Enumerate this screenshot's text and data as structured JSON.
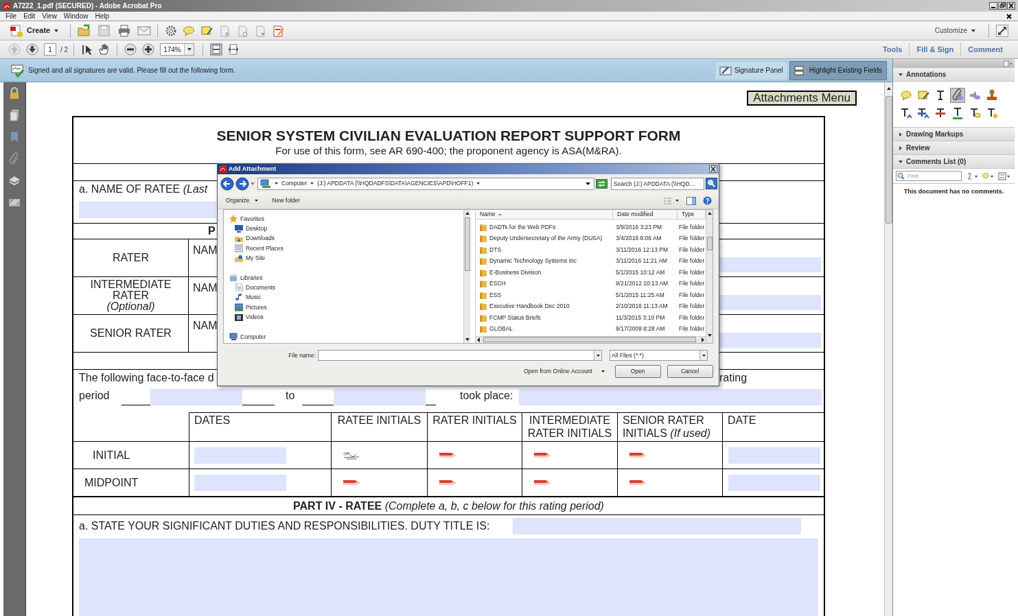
{
  "window": {
    "title": "A7222_1.pdf (SECURED) - Adobe Acrobat Pro"
  },
  "menu": [
    "File",
    "Edit",
    "View",
    "Window",
    "Help"
  ],
  "toolbar": {
    "create": "Create",
    "customize": "Customize"
  },
  "navigation": {
    "page": "1",
    "page_count": "/ 2",
    "zoom": "174%"
  },
  "task_tabs": [
    "Tools",
    "Fill & Sign",
    "Comment"
  ],
  "notice": {
    "message": "Signed and all signatures are valid.  Please fill out the following form.",
    "buttons": [
      {
        "label": "Signature Panel",
        "selected": false
      },
      {
        "label": "Highlight Existing Fields",
        "selected": true
      }
    ]
  },
  "right_panel": {
    "sections": [
      {
        "title": "Annotations",
        "expanded": true,
        "tools": [
          {
            "selected": false
          },
          {
            "selected": false
          },
          {
            "selected": false
          },
          {
            "selected": true
          },
          {
            "selected": false
          },
          {
            "selected": false
          },
          {
            "selected": false
          },
          {
            "selected": false
          },
          {
            "selected": false
          },
          {
            "selected": false
          },
          {
            "selected": false
          },
          {
            "selected": false
          }
        ]
      },
      {
        "title": "Drawing Markups",
        "expanded": false
      },
      {
        "title": "Review",
        "expanded": false
      },
      {
        "title": "Comments List (0)",
        "expanded": true,
        "find": {
          "placeholder": "Find"
        },
        "empty_message": "This document has no comments."
      }
    ]
  },
  "form": {
    "attachments_button": "Attachments Menu",
    "title": "SENIOR SYSTEM CIVILIAN EVALUATION REPORT SUPPORT FORM",
    "subtitle": "For use of this form, see AR 690-400; the proponent agency is ASA(M&RA).",
    "ratee_name_label": "a.  NAME OF RATEE  *(Last*",
    "part_heading": "P",
    "raters": [
      {
        "label": "RATER",
        "name_label": "NAM"
      },
      {
        "label": "INTERMEDIATE RATER",
        "note": "(Optional)",
        "name_label": "NAM"
      },
      {
        "label": "SENIOR RATER",
        "name_label": "NAM"
      }
    ],
    "counseling_text": "The following face-to-face d",
    "counseling_text_end": "rating",
    "period_label": "period",
    "to_label": "to",
    "took_place_label": "took place:",
    "table": {
      "columns": [
        "DATES",
        "RATEE INITIALS",
        "RATER INITIALS",
        "INTERMEDIATE RATER INITIALS",
        "SENIOR RATER INITIALS  *(If used)*",
        "DATE"
      ],
      "rows": [
        {
          "label": "INITIAL",
          "ratee_signed": true
        },
        {
          "label": "MIDPOINT",
          "ratee_signed": false
        }
      ]
    },
    "part_iv": "**PART IV - RATEE**  *(Complete a, b, c below for this rating period)*",
    "duties_label": "a.  STATE YOUR SIGNIFICANT DUTIES AND RESPONSIBILITIES. DUTY TITLE IS:"
  },
  "dialog": {
    "title": "Add Attachment",
    "path": [
      "Computer",
      "(J:) APDDATA (\\\\HQDADFS\\DATA\\AGENCIES\\APD\\HOFF1)"
    ],
    "search": {
      "placeholder": "Search (J:) APDDATA (\\\\HQD…"
    },
    "commands": [
      "Organize",
      "New folder"
    ],
    "tree": [
      {
        "label": "Favorites",
        "children": [
          {
            "label": "Desktop"
          },
          {
            "label": "Downloads"
          },
          {
            "label": "Recent Places"
          },
          {
            "label": "My Site"
          }
        ]
      },
      {
        "label": "Libraries",
        "children": [
          {
            "label": "Documents"
          },
          {
            "label": "Music"
          },
          {
            "label": "Pictures"
          },
          {
            "label": "Videos"
          }
        ]
      },
      {
        "label": "Computer"
      }
    ],
    "columns": [
      "Name",
      "Date modified",
      "Type"
    ],
    "files": [
      {
        "name": "DADTs for the Web PDFs",
        "date": "3/9/2016 3:23 PM",
        "type": "File folder"
      },
      {
        "name": "Deputy Undersecretary of the Army (DUSA)",
        "date": "3/4/2016 8:06 AM",
        "type": "File folder"
      },
      {
        "name": "DTS",
        "date": "3/11/2016 12:13 PM",
        "type": "File folder"
      },
      {
        "name": "Dynamic Technology Systems Inc",
        "date": "3/11/2016 11:21 AM",
        "type": "File folder"
      },
      {
        "name": "E-Business Division",
        "date": "5/1/2015 10:12 AM",
        "type": "File folder"
      },
      {
        "name": "ESCH",
        "date": "9/21/2012 10:13 AM",
        "type": "File folder"
      },
      {
        "name": "ESS",
        "date": "5/1/2015 11:25 AM",
        "type": "File folder"
      },
      {
        "name": "Executive Handbook Dec 2010",
        "date": "2/10/2016 11:13 AM",
        "type": "File folder"
      },
      {
        "name": "FCMP Status Briefs",
        "date": "11/3/2015 3:10 PM",
        "type": "File folder"
      },
      {
        "name": "GLOBAL",
        "date": "9/17/2009 8:28 AM",
        "type": "File folder"
      }
    ],
    "file_name_label": "File name:",
    "file_type": "All Files (*.*)",
    "online": "Open from Online Account",
    "buttons": [
      "Open",
      "Cancel"
    ]
  }
}
